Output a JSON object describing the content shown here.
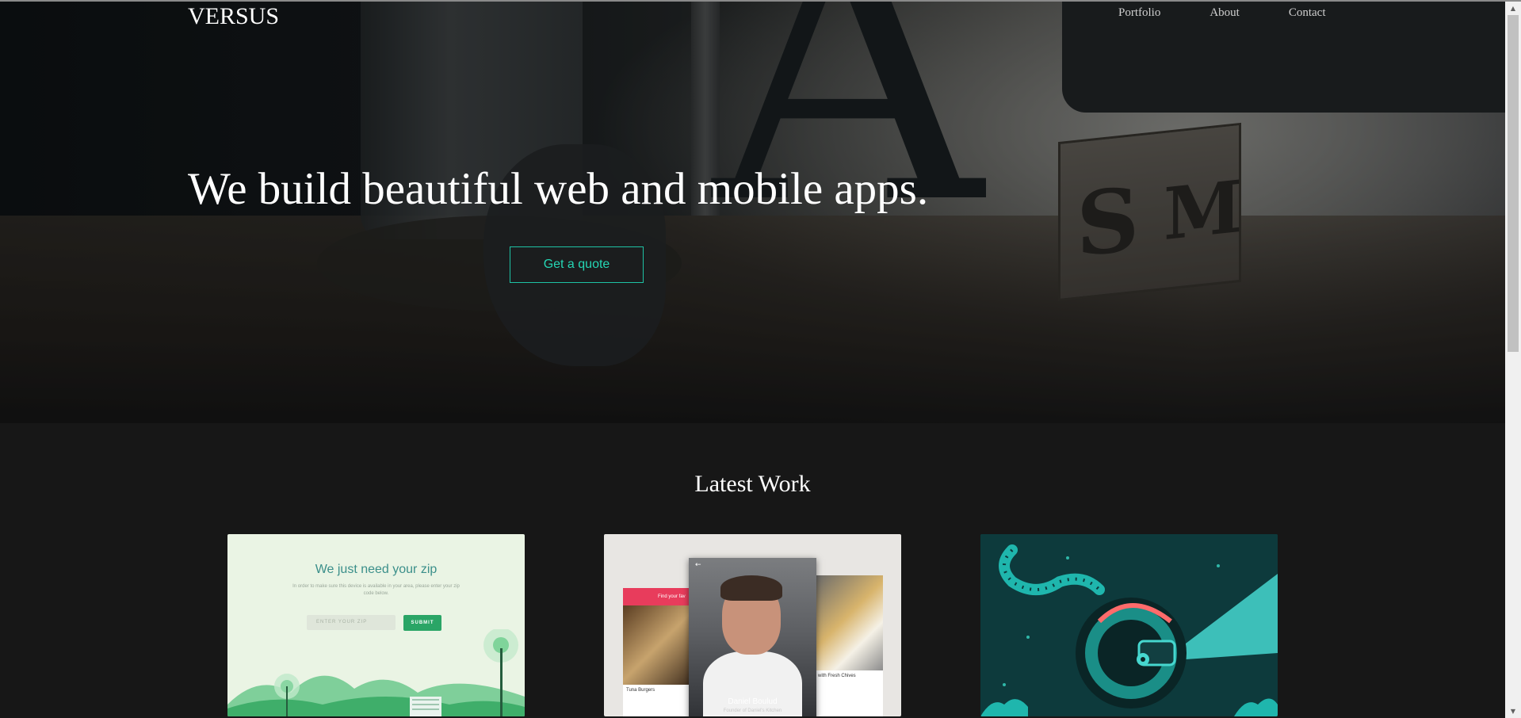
{
  "brand": {
    "logo": "VERSUS"
  },
  "nav": {
    "portfolio": "Portfolio",
    "about": "About",
    "contact": "Contact"
  },
  "hero": {
    "headline": "We build beautiful web and mobile apps.",
    "cta": "Get a quote",
    "accent_color": "#1ec2a4"
  },
  "latest_work": {
    "title": "Latest Work",
    "cards": [
      {
        "zip_title": "We just need your zip",
        "zip_subtitle": "In order to make sure this device is available in your area, please enter your zip code below.",
        "zip_placeholder": "ENTER YOUR ZIP",
        "submit_label": "SUBMIT"
      },
      {
        "left_bar": "Find your fav",
        "left_caption": "Tuna Burgers",
        "right_caption": "with Fresh Chives",
        "chef_name": "Daniel Boulud",
        "chef_role": "Founder of Daniel's Kitchen"
      },
      {
        "illustration": "astronaut-tentacle-illustration"
      }
    ]
  },
  "scrollbar": {
    "up_icon": "arrow-up-icon",
    "down_icon": "arrow-down-icon"
  }
}
